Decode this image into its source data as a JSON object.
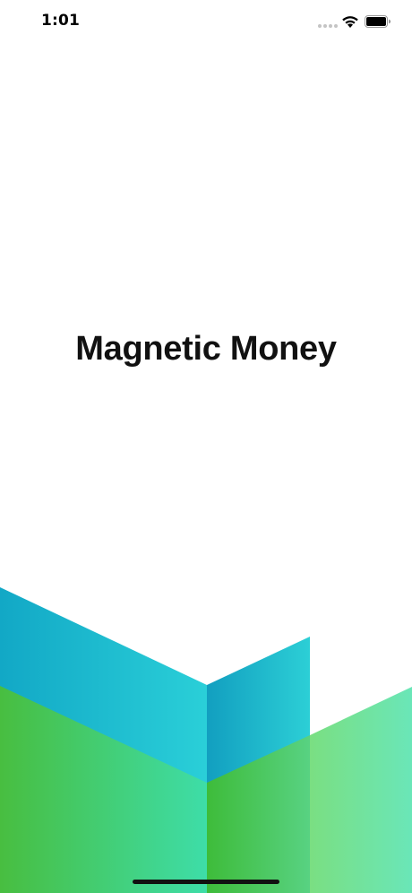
{
  "status_bar": {
    "time": "1:01",
    "icons": [
      "signal-dots-icon",
      "wifi-icon",
      "battery-icon"
    ]
  },
  "splash": {
    "title": "Magnetic Money"
  },
  "logo": {
    "icon": "magnetic-money-logo-icon",
    "colors": {
      "teal_dark": "#12A8C6",
      "teal_light": "#2ACFD8",
      "green_dark": "#42BE3E",
      "green_light": "#3EDDA8",
      "mint": "#6DE6B6"
    }
  }
}
